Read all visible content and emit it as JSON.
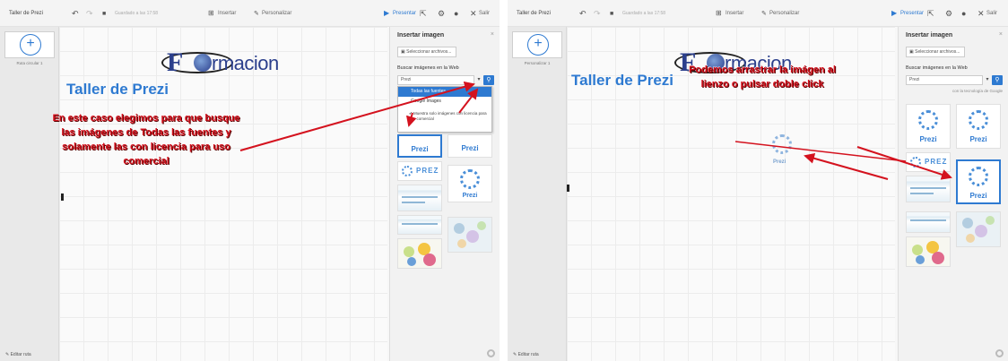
{
  "left": {
    "title": "Taller de Prezi",
    "autosave": "Guardado a las 17:58",
    "insert": "Insertar",
    "customize": "Personalizar",
    "present": "Presentar",
    "exit": "Salir",
    "thumb_label": "Ruta circular 1",
    "edit_path": "Editar ruta",
    "logo_rest": "rmacion",
    "logo_f": "F",
    "canvas_title": "Taller de Prezi",
    "annotation": "En este caso elegimos para que busque las imágenes de Todas las fuentes y solamente las con licencia para uso comercial",
    "panel": {
      "title": "Insertar imagen",
      "close": "×",
      "select_files": "Seleccionar archivos...",
      "search_label": "Buscar imágenes en la Web",
      "query": "Prezi",
      "dropdown": [
        "Todas las fuentes",
        "Google Images"
      ],
      "checkbox": "Muestra solo imágenes con licencia para uso comercial"
    },
    "tiles": [
      "Prezi",
      "Prezi",
      "Prezi"
    ]
  },
  "right": {
    "title": "Taller de Prezi",
    "autosave": "Guardado a las 17:58",
    "insert": "Insertar",
    "customize": "Personalizar",
    "present": "Presentar",
    "exit": "Salir",
    "thumb_label": "Personalizar 1",
    "edit_path": "Editar ruta",
    "logo_rest": "rmacion",
    "logo_f": "F",
    "canvas_title": "Taller de Prezi",
    "annotation": "Podemos arrastrar la imágen al lienzo o pulsar doble click",
    "dropped_label": "Prezi",
    "panel": {
      "title": "Insertar imagen",
      "close": "×",
      "select_files": "Seleccionar archivos...",
      "search_label": "Buscar imágenes en la Web",
      "query": "Prezi",
      "powered": "con la tecnología de Google"
    },
    "tiles": [
      "Prezi",
      "Prezi",
      "Prezi"
    ]
  },
  "colors": {
    "accent": "#2e7ad1",
    "annotation": "#d4121e",
    "logo": "#2b3f8c"
  },
  "icons": [
    "undo-icon",
    "redo-icon",
    "save-icon",
    "insert-icon",
    "customize-icon",
    "present-icon",
    "share-icon",
    "settings-icon",
    "help-icon",
    "close-icon",
    "search-icon",
    "gear-icon"
  ]
}
